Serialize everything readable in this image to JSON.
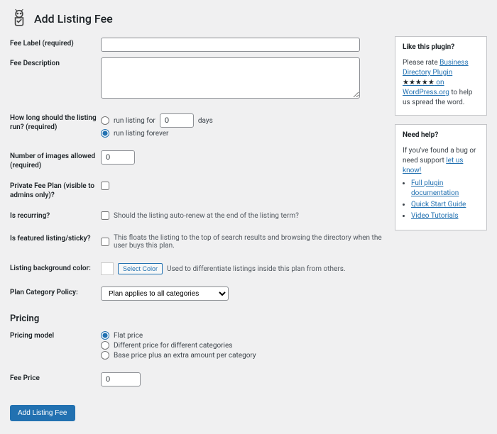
{
  "header": {
    "title": "Add Listing Fee"
  },
  "form": {
    "feeLabel": {
      "label": "Fee Label (required)",
      "value": ""
    },
    "feeDescription": {
      "label": "Fee Description",
      "value": ""
    },
    "runDuration": {
      "label": "How long should the listing run? (required)",
      "optFor": "run listing for",
      "daysValue": "0",
      "daysSuffix": "days",
      "optForever": "run listing forever"
    },
    "images": {
      "label": "Number of images allowed (required)",
      "value": "0"
    },
    "privatePlan": {
      "label": "Private Fee Plan (visible to admins only)?"
    },
    "recurring": {
      "label": "Is recurring?",
      "desc": "Should the listing auto-renew at the end of the listing term?"
    },
    "featured": {
      "label": "Is featured listing/sticky?",
      "desc": "This floats the listing to the top of search results and browsing the directory when the user buys this plan."
    },
    "bgColor": {
      "label": "Listing background color:",
      "btn": "Select Color",
      "desc": "Used to differentiate listings inside this plan from others."
    },
    "categoryPolicy": {
      "label": "Plan Category Policy:",
      "selected": "Plan applies to all categories"
    },
    "pricingHeading": "Pricing",
    "pricingModel": {
      "label": "Pricing model",
      "optFlat": "Flat price",
      "optDiff": "Different price for different categories",
      "optBase": "Base price plus an extra amount per category"
    },
    "feePrice": {
      "label": "Fee Price",
      "value": "0"
    },
    "submit": "Add Listing Fee"
  },
  "sidebar": {
    "like": {
      "title": "Like this plugin?",
      "prefix": "Please rate ",
      "link1": "Business Directory Plugin",
      "stars": "★★★★★",
      "wp": " on WordPress.org",
      "suffix": " to help us spread the word."
    },
    "help": {
      "title": "Need help?",
      "lead1": "If you've found a bug or need support ",
      "leadLink": "let us know!",
      "links": [
        "Full plugin documentation",
        "Quick Start Guide",
        "Video Tutorials"
      ]
    }
  }
}
